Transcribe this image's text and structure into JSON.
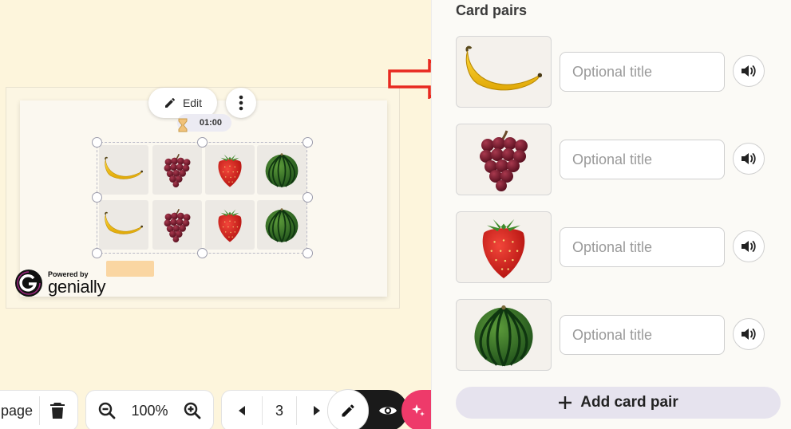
{
  "editor": {
    "edit_label": "Edit",
    "timer": "01:00",
    "powered_by": "Powered by",
    "brand": "genially"
  },
  "board": {
    "cells": [
      {
        "fruit": "banana"
      },
      {
        "fruit": "grapes"
      },
      {
        "fruit": "strawberry"
      },
      {
        "fruit": "watermelon"
      },
      {
        "fruit": "banana"
      },
      {
        "fruit": "grapes"
      },
      {
        "fruit": "strawberry"
      },
      {
        "fruit": "watermelon"
      }
    ]
  },
  "toolbar": {
    "page_label": "page",
    "zoom": "100%",
    "page_number": "3"
  },
  "panel": {
    "title": "Card pairs",
    "pairs": [
      {
        "image": "banana",
        "placeholder": "Optional title"
      },
      {
        "image": "grapes",
        "placeholder": "Optional title"
      },
      {
        "image": "strawberry",
        "placeholder": "Optional title"
      },
      {
        "image": "watermelon",
        "placeholder": "Optional title"
      }
    ],
    "add_label": "Add card pair"
  },
  "colors": {
    "canvas_bg": "#fdf5dc",
    "arrow": "#e8291f",
    "ai_button": "#ee3a6a",
    "add_button": "#e6e3ee"
  }
}
